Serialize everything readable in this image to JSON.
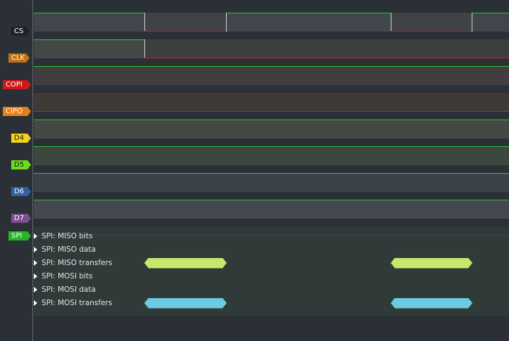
{
  "channels": [
    {
      "name": "CS",
      "color": "#1e2126",
      "text_color": "#ffffff",
      "lane_color": "#41464c",
      "low_color": "#3f4247",
      "wave_color": "#27c827"
    },
    {
      "name": "CLK",
      "color": "#c27212",
      "text_color": "#ffffff",
      "lane_color": "#3b3f3d",
      "low_color": "#3b3f3d",
      "wave_color": "#27c827"
    },
    {
      "name": "COPI",
      "color": "#d1181a",
      "text_color": "#ffffff",
      "lane_color": "#433d3f",
      "low_color": "#3c393b",
      "wave_color": "#27c827"
    },
    {
      "name": "CIPO",
      "color": "#e8801a",
      "text_color": "#ffffff",
      "lane_color": "#3d3a37",
      "low_color": "#393634",
      "wave_color": "#d01c1c"
    },
    {
      "name": "D4",
      "color": "#f2d21c",
      "text_color": "#1a1a1a",
      "lane_color": "#444a41",
      "low_color": "#3f443d",
      "wave_color": "#27c827"
    },
    {
      "name": "D5",
      "color": "#6cdc1f",
      "text_color": "#1a1a1a",
      "lane_color": "#3e4640",
      "low_color": "#3a413c",
      "wave_color": "#27c827"
    },
    {
      "name": "D6",
      "color": "#2f5fa5",
      "text_color": "#ffffff",
      "lane_color": "#3c4249",
      "low_color": "#393e45",
      "wave_color": "#27c827"
    },
    {
      "name": "D7",
      "color": "#7d4f8f",
      "text_color": "#ffffff",
      "lane_color": "#45484f",
      "low_color": "#404349",
      "wave_color": "#27c827"
    }
  ],
  "analyzer": {
    "name": "SPI",
    "color": "#27b427",
    "text_color": "#ffffff",
    "rows": [
      {
        "label": "SPI: MISO bits"
      },
      {
        "label": "SPI: MISO data"
      },
      {
        "label": "SPI: MISO transfers",
        "color": "#c5e86a"
      },
      {
        "label": "SPI: MOSI bits"
      },
      {
        "label": "SPI: MOSI data"
      },
      {
        "label": "SPI: MOSI transfers",
        "color": "#6ccbe0"
      }
    ]
  }
}
